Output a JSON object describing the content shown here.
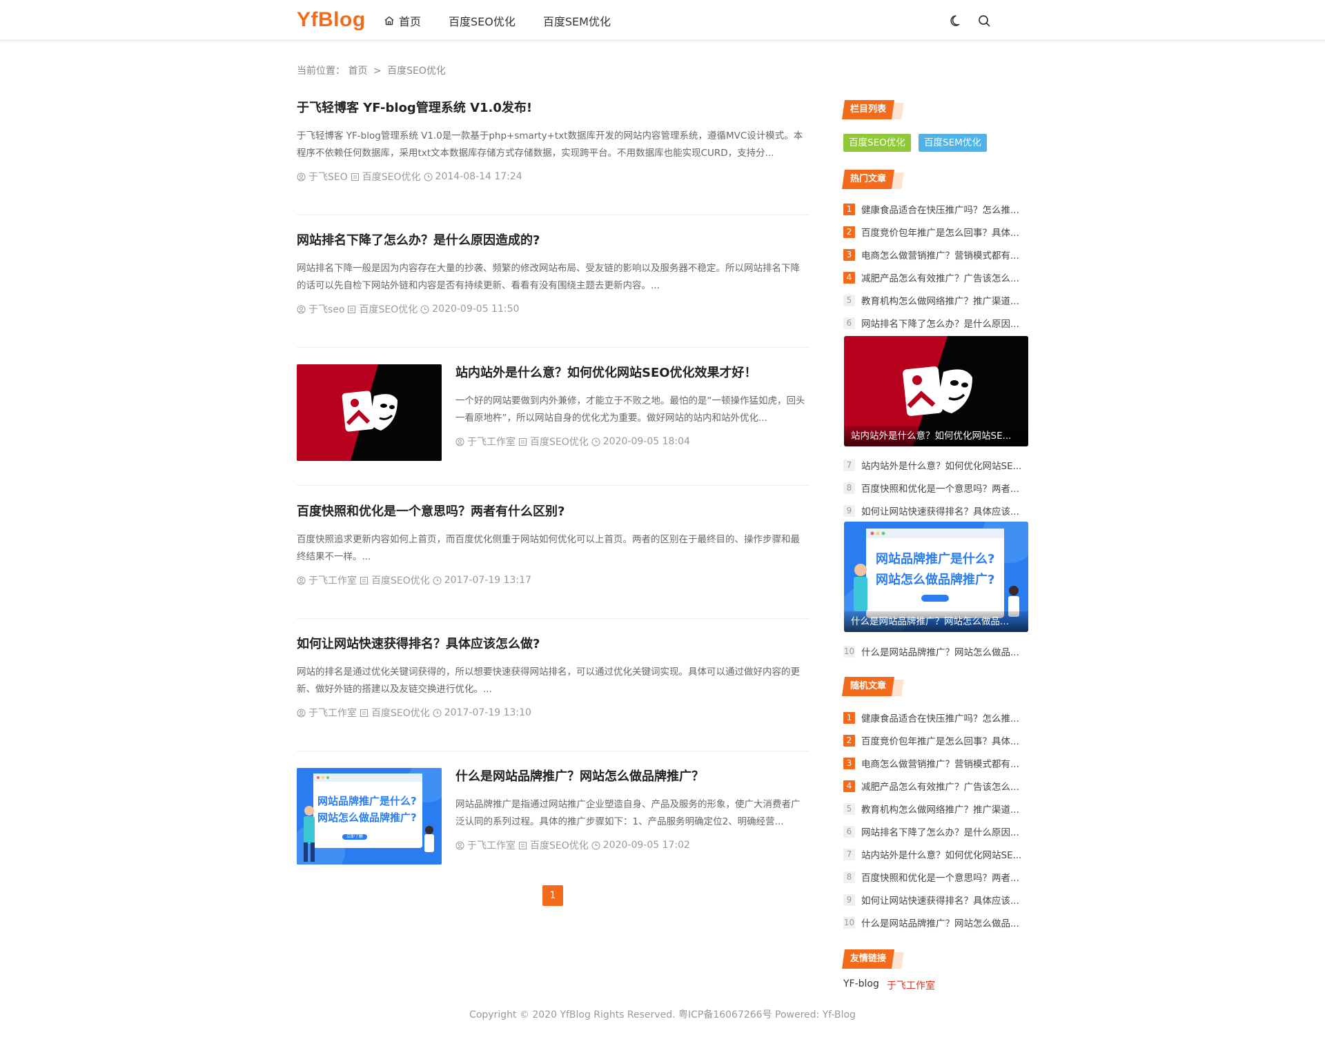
{
  "header": {
    "logo": "YfBlog",
    "nav": [
      {
        "label": "首页"
      },
      {
        "label": "百度SEO优化"
      },
      {
        "label": "百度SEM优化"
      }
    ]
  },
  "breadcrumb": {
    "prefix": "当前位置：",
    "home": "首页",
    "sep": ">",
    "current": "百度SEO优化"
  },
  "posts": [
    {
      "title": "于飞轻博客 YF-blog管理系统 V1.0发布!",
      "excerpt": "于飞轻博客 YF-blog管理系统 V1.0是一款基于php+smarty+txt数据库开发的网站内容管理系统，遵循MVC设计模式。本程序不依赖任何数据库，采用txt文本数据库存储方式存储数据，实现跨平台。不用数据库也能实现CURD，支持分...",
      "author": "于飞SEO",
      "category": "百度SEO优化",
      "date": "2014-08-14 17:24"
    },
    {
      "title": "网站排名下降了怎么办？是什么原因造成的?",
      "excerpt": "网站排名下降一般是因为内容存在大量的抄袭、频繁的修改网站布局、受友链的影响以及服务器不稳定。所以网站排名下降的话可以先自检下网站外链和内容是否有持续更新、看看有没有围绕主题去更新内容。...",
      "author": "于飞seo",
      "category": "百度SEO优化",
      "date": "2020-09-05 11:50"
    },
    {
      "title": "站内站外是什么意？如何优化网站SEO优化效果才好！",
      "excerpt": "一个好的网站要做到内外兼修，才能立于不败之地。最怕的是“一顿操作猛如虎，回头一看原地杵”，所以网站自身的优化尤为重要。做好网站的站内和站外优化...",
      "author": "于飞工作室",
      "category": "百度SEO优化",
      "date": "2020-09-05 18:04"
    },
    {
      "title": "百度快照和优化是一个意思吗？两者有什么区别?",
      "excerpt": "百度快照追求更新内容如何上首页，而百度优化侧重于网站如何优化可以上首页。两者的区别在于最终目的、操作步骤和最终结果不一样。...",
      "author": "于飞工作室",
      "category": "百度SEO优化",
      "date": "2017-07-19 13:17"
    },
    {
      "title": "如何让网站快速获得排名？具体应该怎么做?",
      "excerpt": "网站的排名是通过优化关键词获得的，所以想要快速获得网站排名，可以通过优化关键词实现。具体可以通过做好内容的更新、做好外链的搭建以及友链交换进行优化。...",
      "author": "于飞工作室",
      "category": "百度SEO优化",
      "date": "2017-07-19 13:10"
    },
    {
      "title": "什么是网站品牌推广？网站怎么做品牌推广？",
      "excerpt": "网站品牌推广是指通过网站推广企业塑造自身、产品及服务的形象，使广大消费者广泛认同的系列过程。具体的推广步骤如下：1、产品服务明确定位2、明确经营...",
      "author": "于飞工作室",
      "category": "百度SEO优化",
      "date": "2020-09-05 17:02"
    }
  ],
  "thumb_texts": {
    "brand_line1": "网站品牌推广是什么?",
    "brand_line2": "网站怎么做品牌推广?",
    "brand_btn": "立即了解"
  },
  "pagination": {
    "current": "1"
  },
  "sidebar": {
    "cat_heading": "栏目列表",
    "categories": [
      {
        "label": "百度SEO优化",
        "color": "#8fc93a"
      },
      {
        "label": "百度SEM优化",
        "color": "#4fb3e8"
      }
    ],
    "hot_heading": "热门文章",
    "hot": [
      {
        "num": "1",
        "title": "健康食品适合在快压推广吗？怎么推..."
      },
      {
        "num": "2",
        "title": "百度竞价包年推广是怎么回事？具体..."
      },
      {
        "num": "3",
        "title": "电商怎么做营销推广？营销模式都有..."
      },
      {
        "num": "4",
        "title": "减肥产品怎么有效推广？广告该怎么..."
      },
      {
        "num": "5",
        "title": "教育机构怎么做网络推广？推广渠道..."
      },
      {
        "num": "6",
        "title": "网站排名下降了怎么办？是什么原因..."
      },
      {
        "num": "7",
        "title": "站内站外是什么意？如何优化网站SE..."
      },
      {
        "num": "8",
        "title": "百度快照和优化是一个意思吗？两者..."
      },
      {
        "num": "9",
        "title": "如何让网站快速获得排名？具体应该..."
      },
      {
        "num": "10",
        "title": "什么是网站品牌推广？网站怎么做品..."
      }
    ],
    "hot_card1_caption": "站内站外是什么意？如何优化网站SE...",
    "hot_card2_caption": "什么是网站品牌推广？网站怎么做品...",
    "random_heading": "随机文章",
    "random": [
      {
        "num": "1",
        "title": "健康食品适合在快压推广吗？怎么推..."
      },
      {
        "num": "2",
        "title": "百度竞价包年推广是怎么回事？具体..."
      },
      {
        "num": "3",
        "title": "电商怎么做营销推广？营销模式都有..."
      },
      {
        "num": "4",
        "title": "减肥产品怎么有效推广？广告该怎么..."
      },
      {
        "num": "5",
        "title": "教育机构怎么做网络推广？推广渠道..."
      },
      {
        "num": "6",
        "title": "网站排名下降了怎么办？是什么原因..."
      },
      {
        "num": "7",
        "title": "站内站外是什么意？如何优化网站SE..."
      },
      {
        "num": "8",
        "title": "百度快照和优化是一个意思吗？两者..."
      },
      {
        "num": "9",
        "title": "如何让网站快速获得排名？具体应该..."
      },
      {
        "num": "10",
        "title": "什么是网站品牌推广？网站怎么做品..."
      }
    ],
    "links_heading": "友情链接",
    "links": [
      {
        "label": "YF-blog",
        "color": "#333333"
      },
      {
        "label": "于飞工作室",
        "color": "#e0301e"
      }
    ]
  },
  "footer": {
    "text": "Copyright © 2020 YfBlog Rights Reserved. 粤ICP备16067266号 Powered: Yf-Blog"
  },
  "colors": {
    "accent": "#f26b1d",
    "thumb_red": "#b8001f",
    "thumb_blue": "#2a7df0"
  }
}
